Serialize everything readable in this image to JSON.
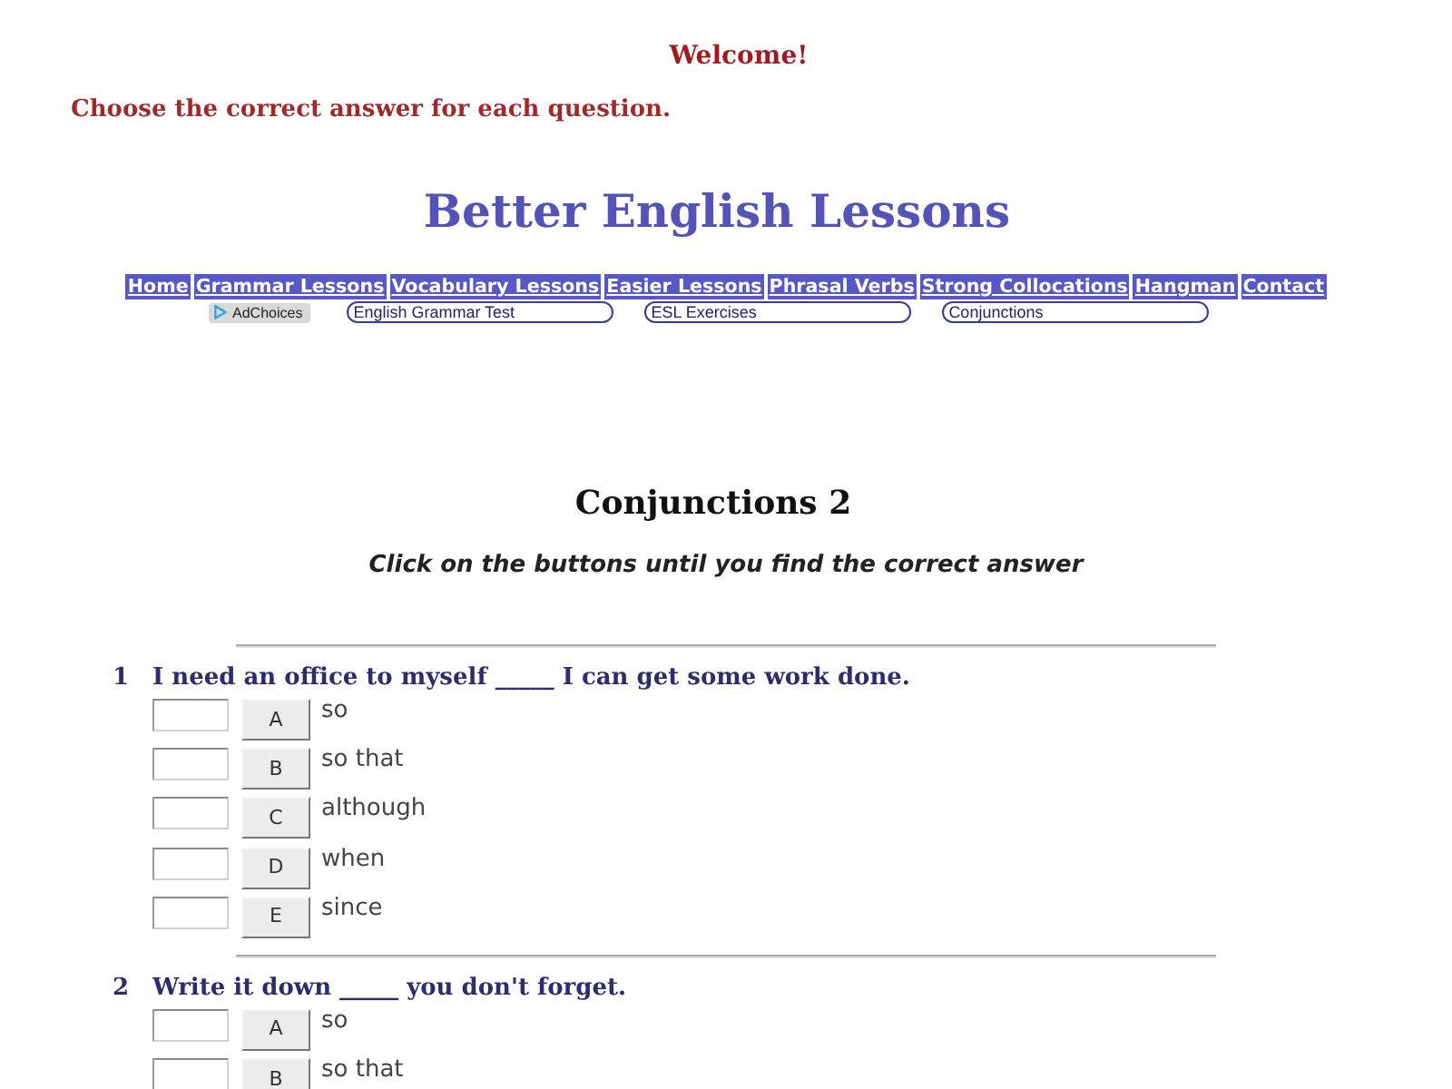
{
  "header": {
    "welcome": "Welcome!",
    "instruction": "Choose the correct answer for each question."
  },
  "site_title": "Better English Lessons",
  "nav": [
    {
      "label": "Home"
    },
    {
      "label": "Grammar Lessons"
    },
    {
      "label": "Vocabulary Lessons"
    },
    {
      "label": "Easier Lessons"
    },
    {
      "label": "Phrasal Verbs"
    },
    {
      "label": "Strong Collocations"
    },
    {
      "label": "Hangman"
    },
    {
      "label": "Contact"
    }
  ],
  "ad_row": {
    "adchoices": "AdChoices",
    "links": [
      "English Grammar Test",
      "ESL Exercises",
      "Conjunctions"
    ]
  },
  "exercise": {
    "title": "Conjunctions 2",
    "subtitle": "Click on the buttons until you find the correct answer"
  },
  "questions": [
    {
      "number": "1",
      "text": "I need an office to myself _____ I can get some work done.",
      "options": [
        {
          "letter": "A",
          "text": "so"
        },
        {
          "letter": "B",
          "text": "so that"
        },
        {
          "letter": "C",
          "text": "although"
        },
        {
          "letter": "D",
          "text": "when"
        },
        {
          "letter": "E",
          "text": "since"
        }
      ]
    },
    {
      "number": "2",
      "text": "Write it down _____ you don't forget.",
      "options": [
        {
          "letter": "A",
          "text": "so"
        },
        {
          "letter": "B",
          "text": "so that"
        }
      ]
    }
  ]
}
